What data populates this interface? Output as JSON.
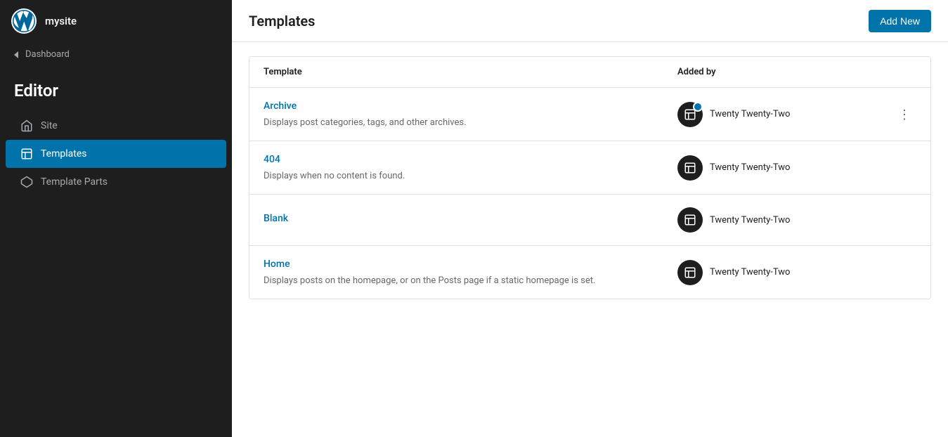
{
  "sidebar": {
    "site_name": "mysite",
    "dashboard_label": "Dashboard",
    "editor_title": "Editor",
    "nav_items": [
      {
        "id": "site",
        "label": "Site",
        "icon": "home-icon",
        "active": false
      },
      {
        "id": "templates",
        "label": "Templates",
        "icon": "layout-icon",
        "active": true
      },
      {
        "id": "template-parts",
        "label": "Template Parts",
        "icon": "diamond-icon",
        "active": false
      }
    ]
  },
  "header": {
    "title": "Templates",
    "add_new_label": "Add New"
  },
  "table": {
    "columns": [
      {
        "id": "template",
        "label": "Template"
      },
      {
        "id": "added_by",
        "label": "Added by"
      }
    ],
    "rows": [
      {
        "id": "archive",
        "name": "Archive",
        "description": "Displays post categories, tags, and other archives.",
        "added_by": "Twenty Twenty-Two",
        "has_dot": true,
        "has_actions": true
      },
      {
        "id": "404",
        "name": "404",
        "description": "Displays when no content is found.",
        "added_by": "Twenty Twenty-Two",
        "has_dot": false,
        "has_actions": false
      },
      {
        "id": "blank",
        "name": "Blank",
        "description": "",
        "added_by": "Twenty Twenty-Two",
        "has_dot": false,
        "has_actions": false
      },
      {
        "id": "home",
        "name": "Home",
        "description": "Displays posts on the homepage, or on the Posts page if a static homepage is set.",
        "added_by": "Twenty Twenty-Two",
        "has_dot": false,
        "has_actions": false
      }
    ]
  }
}
